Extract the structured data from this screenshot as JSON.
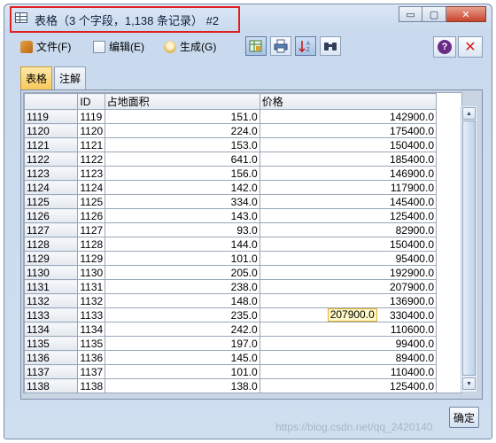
{
  "window": {
    "title": "表格（3 个字段，1,138 条记录） #2",
    "controls": {
      "minimize": "▭",
      "maximize": "▢",
      "close": "✕"
    }
  },
  "menu": [
    {
      "label": "文件(F)",
      "icon": "file-icon"
    },
    {
      "label": "编辑(E)",
      "icon": "edit-icon"
    },
    {
      "label": "生成(G)",
      "icon": "generate-icon"
    }
  ],
  "toolbar": {
    "buttons": [
      "grid-export-icon",
      "print-icon",
      "sort-icon",
      "binoculars-icon"
    ],
    "help_label": "?",
    "close_label": "✕"
  },
  "tabs": [
    {
      "label": "表格",
      "active": true
    },
    {
      "label": "注解",
      "active": false
    }
  ],
  "table": {
    "columns": [
      "",
      "ID",
      "占地面积",
      "价格"
    ],
    "rows": [
      [
        "1119",
        "1119",
        "151.0",
        "142900.0"
      ],
      [
        "1120",
        "1120",
        "224.0",
        "175400.0"
      ],
      [
        "1121",
        "1121",
        "153.0",
        "150400.0"
      ],
      [
        "1122",
        "1122",
        "641.0",
        "185400.0"
      ],
      [
        "1123",
        "1123",
        "156.0",
        "146900.0"
      ],
      [
        "1124",
        "1124",
        "142.0",
        "117900.0"
      ],
      [
        "1125",
        "1125",
        "334.0",
        "145400.0"
      ],
      [
        "1126",
        "1126",
        "143.0",
        "125400.0"
      ],
      [
        "1127",
        "1127",
        "93.0",
        "82900.0"
      ],
      [
        "1128",
        "1128",
        "144.0",
        "150400.0"
      ],
      [
        "1129",
        "1129",
        "101.0",
        "95400.0"
      ],
      [
        "1130",
        "1130",
        "205.0",
        "192900.0"
      ],
      [
        "1131",
        "1131",
        "238.0",
        "207900.0"
      ],
      [
        "1132",
        "1132",
        "148.0",
        "136900.0"
      ],
      [
        "1133",
        "1133",
        "235.0",
        "330400.0"
      ],
      [
        "1134",
        "1134",
        "242.0",
        "110600.0"
      ],
      [
        "1135",
        "1135",
        "197.0",
        "99400.0"
      ],
      [
        "1136",
        "1136",
        "145.0",
        "89400.0"
      ],
      [
        "1137",
        "1137",
        "101.0",
        "110400.0"
      ],
      [
        "1138",
        "1138",
        "138.0",
        "125400.0"
      ]
    ],
    "tooltip": {
      "row_index": 14,
      "text": "207900.0"
    }
  },
  "ok_label": "确定",
  "watermark": "https://blog.csdn.net/qq_2420140",
  "colors": {
    "title_highlight": "#e02020",
    "tab_active": "#f7c95a",
    "tooltip_bg": "#fff8c8"
  }
}
